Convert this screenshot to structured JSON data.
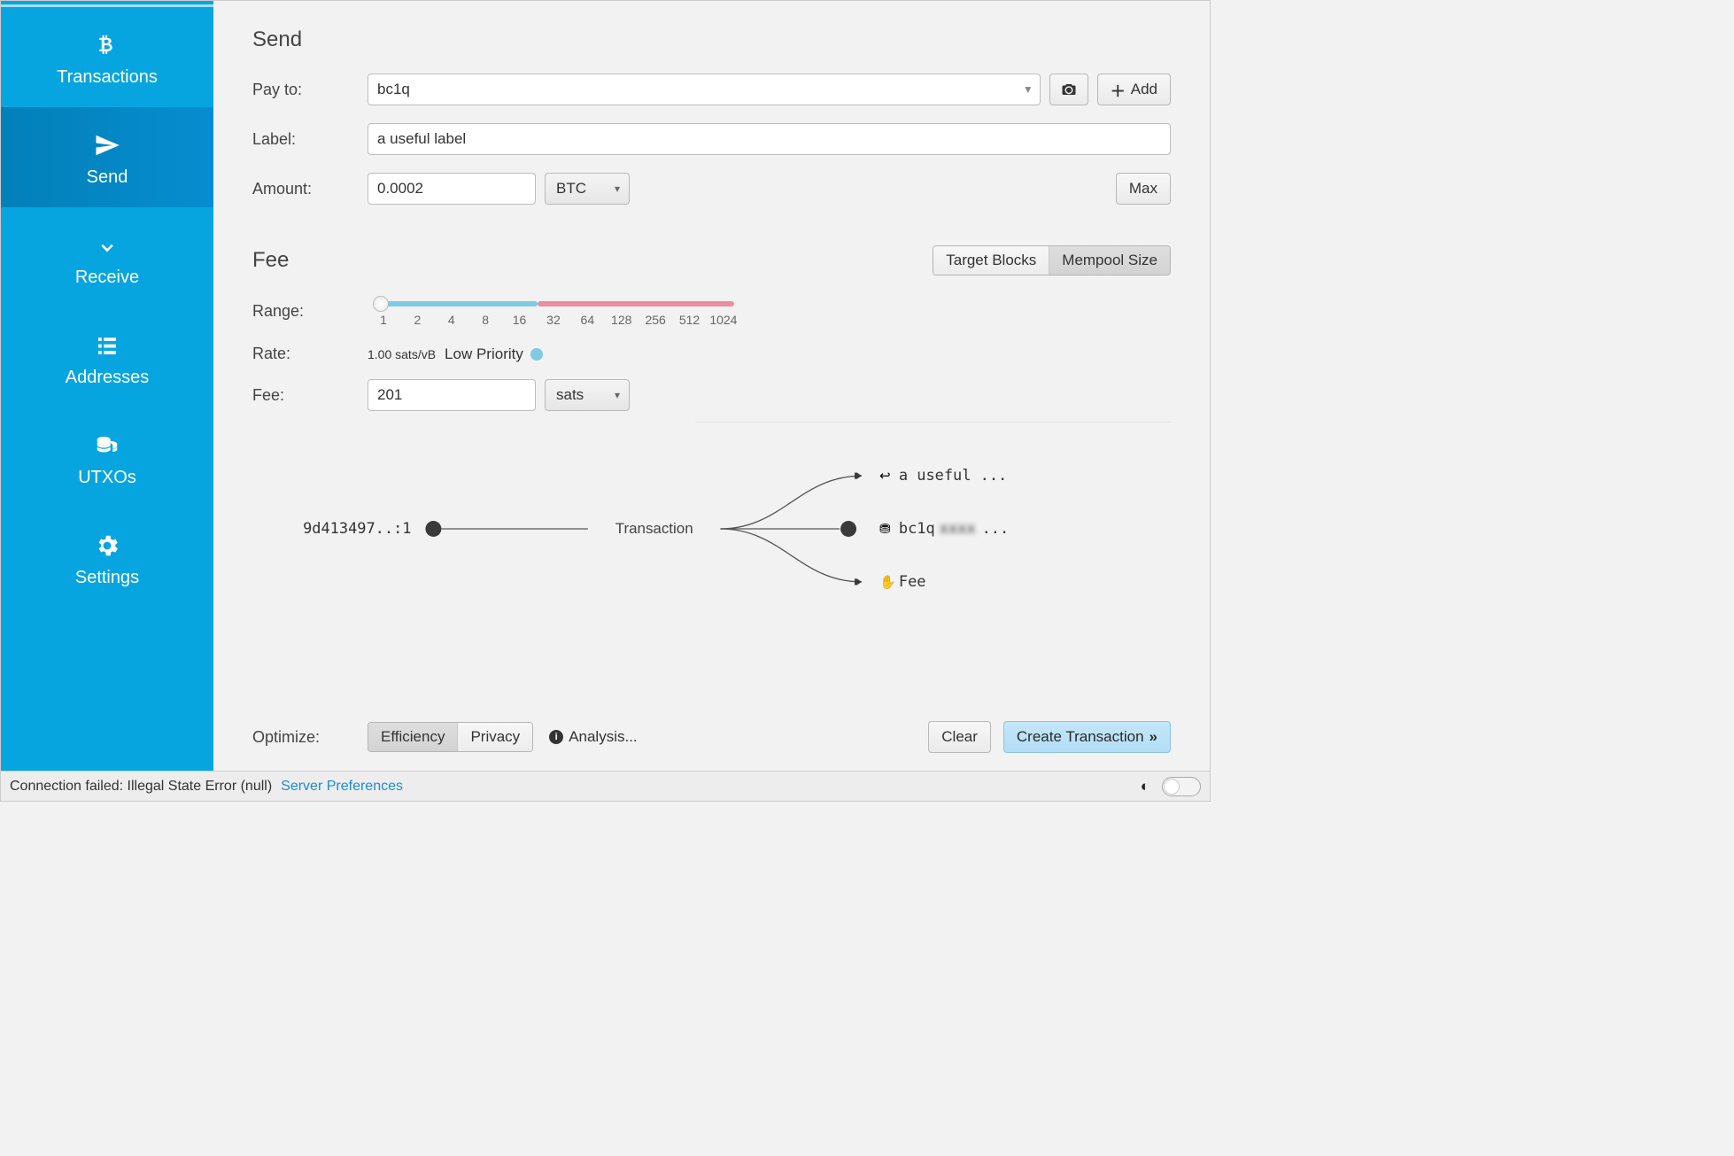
{
  "sidebar": {
    "items": [
      {
        "label": "Transactions"
      },
      {
        "label": "Send"
      },
      {
        "label": "Receive"
      },
      {
        "label": "Addresses"
      },
      {
        "label": "UTXOs"
      },
      {
        "label": "Settings"
      }
    ],
    "active_index": 1
  },
  "send": {
    "title": "Send",
    "pay_to_label": "Pay to:",
    "pay_to_prefix": "bc1q",
    "label_label": "Label:",
    "label_value": "a useful label",
    "amount_label": "Amount:",
    "amount_value": "0.0002",
    "amount_unit": "BTC",
    "add_button": "Add",
    "max_button": "Max"
  },
  "fee": {
    "title": "Fee",
    "target_blocks": "Target Blocks",
    "mempool_size": "Mempool Size",
    "range_label": "Range:",
    "range_ticks": [
      "1",
      "2",
      "4",
      "8",
      "16",
      "32",
      "64",
      "128",
      "256",
      "512",
      "1024"
    ],
    "rate_label": "Rate:",
    "rate_value": "1.00 sats/vB",
    "priority_text": "Low Priority",
    "fee_label": "Fee:",
    "fee_value": "201",
    "fee_unit": "sats"
  },
  "diagram": {
    "input_label": "9d413497..:1",
    "tx_label": "Transaction",
    "outputs": [
      {
        "icon": "reply",
        "text": "a useful ..."
      },
      {
        "icon": "coins",
        "text_prefix": "bc1q",
        "text_suffix": "..."
      },
      {
        "icon": "hand",
        "text": "Fee"
      }
    ]
  },
  "optimize": {
    "label": "Optimize:",
    "efficiency": "Efficiency",
    "privacy": "Privacy",
    "analysis": "Analysis...",
    "clear": "Clear",
    "create": "Create Transaction"
  },
  "status": {
    "text": "Connection failed: Illegal State Error (null)",
    "link": "Server Preferences"
  }
}
